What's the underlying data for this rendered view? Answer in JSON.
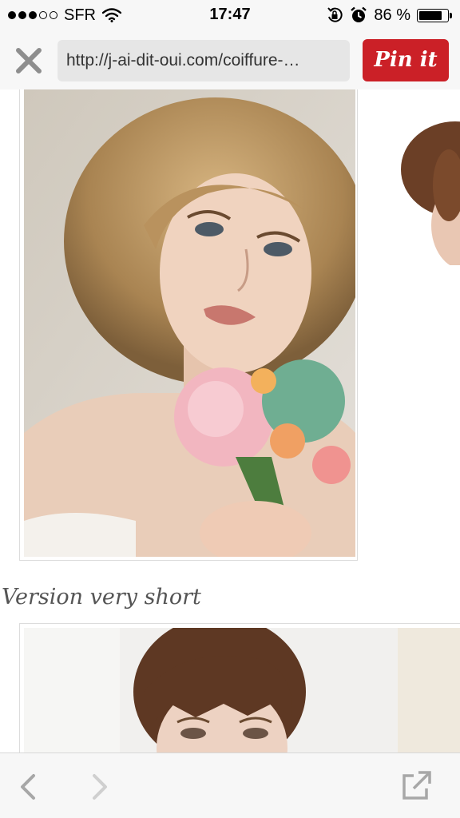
{
  "status_bar": {
    "carrier": "SFR",
    "time": "17:47",
    "battery_percent": "86 %",
    "battery_level": 0.86,
    "signal_bars_filled": 3,
    "signal_bars_total": 5,
    "icons": [
      "wifi-icon",
      "rotation-lock-icon",
      "alarm-icon",
      "battery-icon"
    ]
  },
  "header": {
    "close_icon": "close-icon",
    "url": "http://j-ai-dit-oui.com/coiffure-…",
    "pin_button_label": "Pin it",
    "accent_color": "#cb2027"
  },
  "content": {
    "section_heading": "Version very short"
  },
  "bottom_bar": {
    "icons": [
      "back-arrow-icon",
      "forward-arrow-icon",
      "share-icon"
    ]
  }
}
